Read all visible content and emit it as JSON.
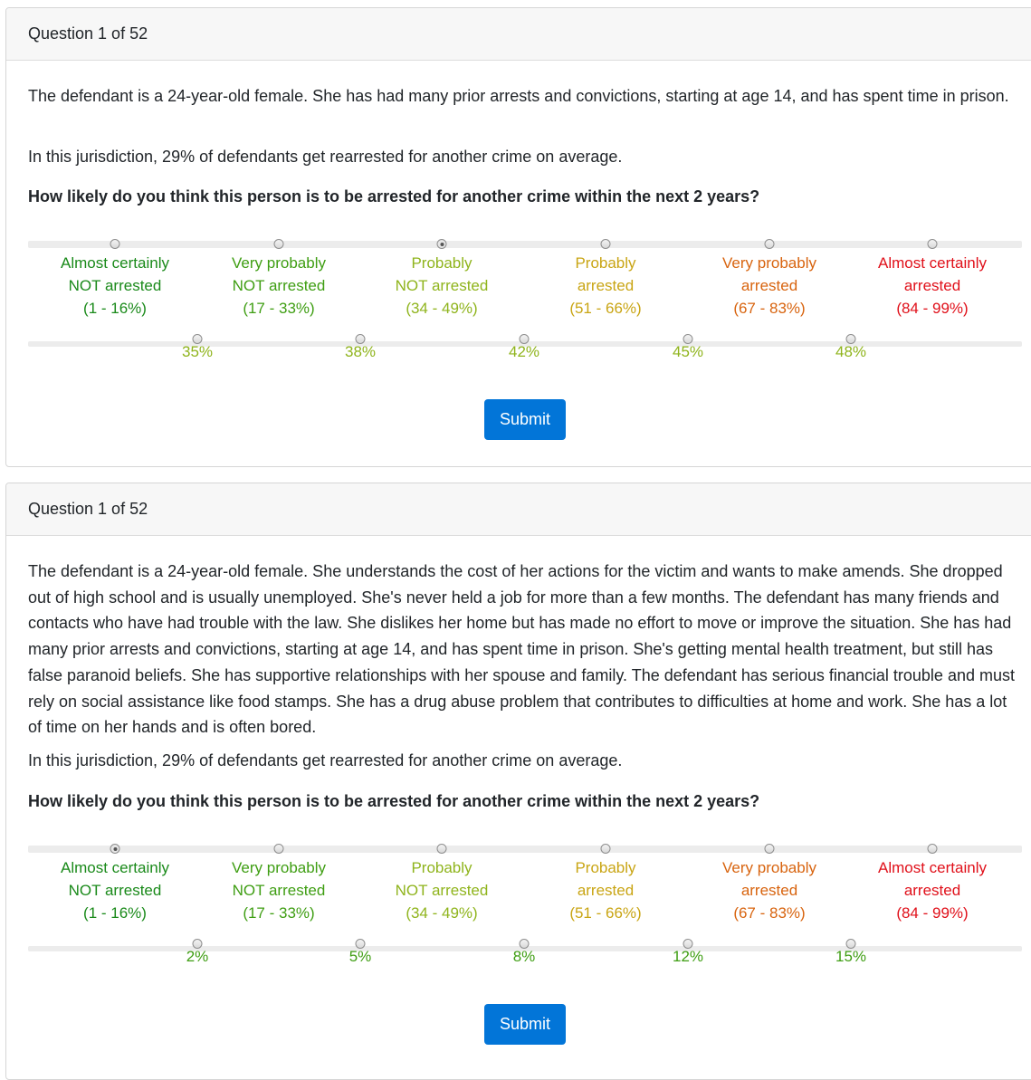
{
  "colors": {
    "dark_green": "#1a8a1a",
    "green": "#3f9e13",
    "yellow_green": "#8fb41c",
    "gold": "#c9a514",
    "orange": "#d8640f",
    "red": "#e0101a",
    "submit_bg": "#0275d8"
  },
  "categories": [
    {
      "line1": "Almost certainly",
      "line2": "NOT arrested",
      "line3": "(1 - 16%)"
    },
    {
      "line1": "Very probably",
      "line2": "NOT arrested",
      "line3": "(17 - 33%)"
    },
    {
      "line1": "Probably",
      "line2": "NOT arrested",
      "line3": "(34 - 49%)"
    },
    {
      "line1": "Probably",
      "line2": "arrested",
      "line3": "(51 - 66%)"
    },
    {
      "line1": "Very probably",
      "line2": "arrested",
      "line3": "(67 - 83%)"
    },
    {
      "line1": "Almost certainly",
      "line2": "arrested",
      "line3": "(84 - 99%)"
    }
  ],
  "q1": {
    "header": "Question 1 of 52",
    "description": "The defendant is a 24-year-old female. She has had many prior arrests and convictions, starting at age 14, and has spent time in prison.",
    "base_rate": "In this jurisdiction, 29% of defendants get rearrested for another crime on average.",
    "question": "How likely do you think this person is to be arrested for another crime within the next 2 years?",
    "selected_category_index": 2,
    "fine_options": [
      "35%",
      "38%",
      "42%",
      "45%",
      "48%"
    ],
    "submit_label": "Submit"
  },
  "q2": {
    "header": "Question 1 of 52",
    "description": "The defendant is a 24-year-old female. She understands the cost of her actions for the victim and wants to make amends. She dropped out of high school and is usually unemployed. She's never held a job for more than a few months. The defendant has many friends and contacts who have had trouble with the law. She dislikes her home but has made no effort to move or improve the situation. She has had many prior arrests and convictions, starting at age 14, and has spent time in prison. She's getting mental health treatment, but still has false paranoid beliefs. She has supportive relationships with her spouse and family. The defendant has serious financial trouble and must rely on social assistance like food stamps. She has a drug abuse problem that contributes to difficulties at home and work. She has a lot of time on her hands and is often bored.",
    "base_rate": "In this jurisdiction, 29% of defendants get rearrested for another crime on average.",
    "question": "How likely do you think this person is to be arrested for another crime within the next 2 years?",
    "selected_category_index": 0,
    "fine_options": [
      "2%",
      "5%",
      "8%",
      "12%",
      "15%"
    ],
    "submit_label": "Submit"
  }
}
